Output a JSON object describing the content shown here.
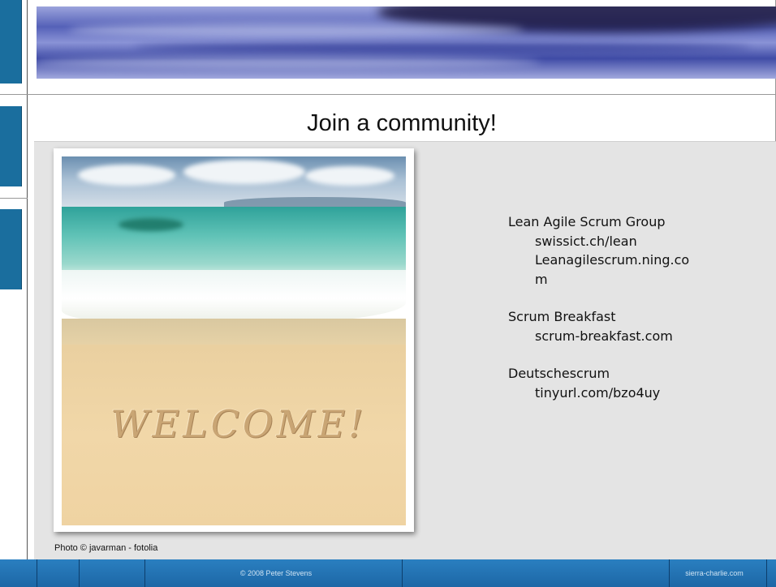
{
  "slide": {
    "title": "Join a community!",
    "photo": {
      "word_in_sand": "WELCOME!",
      "credit": "Photo © javarman - fotolia"
    },
    "groups": [
      {
        "name": "Lean Agile Scrum Group",
        "urls": [
          "swissict.ch/lean",
          "Leanagilescrum.ning.co",
          "m"
        ]
      },
      {
        "name": "Scrum Breakfast",
        "urls": [
          "scrum-breakfast.com"
        ]
      },
      {
        "name": "Deutschescrum",
        "urls": [
          "tinyurl.com/bzo4uy"
        ]
      }
    ]
  },
  "footer": {
    "copyright": "© 2008 Peter Stevens",
    "site": "sierra-charlie.com"
  },
  "colors": {
    "accent": "#1a6e9e",
    "footer": "#2a7fc0",
    "content_bg": "#e4e4e4"
  }
}
